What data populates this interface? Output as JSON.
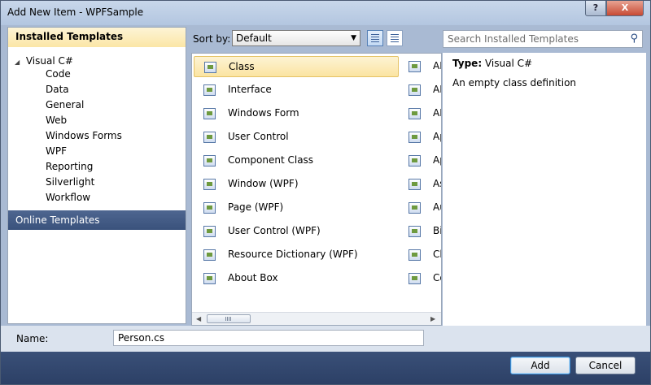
{
  "window": {
    "title": "Add New Item - WPFSample",
    "help_label": "?",
    "close_label": "X"
  },
  "left": {
    "installed_header": "Installed Templates",
    "tree_root": "Visual C#",
    "tree_items": [
      "Code",
      "Data",
      "General",
      "Web",
      "Windows Forms",
      "WPF",
      "Reporting",
      "Silverlight",
      "Workflow"
    ],
    "online_header": "Online Templates"
  },
  "sort": {
    "label": "Sort by:",
    "selected": "Default"
  },
  "templates": [
    {
      "label": "Class",
      "icon": "class-icon",
      "selected": true
    },
    {
      "label": "Interface",
      "icon": "interface-icon"
    },
    {
      "label": "Windows Form",
      "icon": "windows-form-icon"
    },
    {
      "label": "User Control",
      "icon": "user-control-icon"
    },
    {
      "label": "Component Class",
      "icon": "component-class-icon"
    },
    {
      "label": "Window (WPF)",
      "icon": "window-wpf-icon"
    },
    {
      "label": "Page (WPF)",
      "icon": "page-wpf-icon"
    },
    {
      "label": "User Control (WPF)",
      "icon": "user-control-wpf-icon"
    },
    {
      "label": "Resource Dictionary (WPF)",
      "icon": "resource-dictionary-icon"
    },
    {
      "label": "About Box",
      "icon": "about-box-icon"
    }
  ],
  "templates_col2": [
    "AD",
    "AD",
    "AD",
    "Ap",
    "Ap",
    "As",
    "Au",
    "Bit",
    "Cl",
    "Co"
  ],
  "search": {
    "placeholder": "Search Installed Templates"
  },
  "details": {
    "type_label": "Type:",
    "type_value": "Visual C#",
    "description": "An empty class definition"
  },
  "name_field": {
    "label": "Name:",
    "value": "Person.cs"
  },
  "buttons": {
    "add": "Add",
    "cancel": "Cancel"
  }
}
